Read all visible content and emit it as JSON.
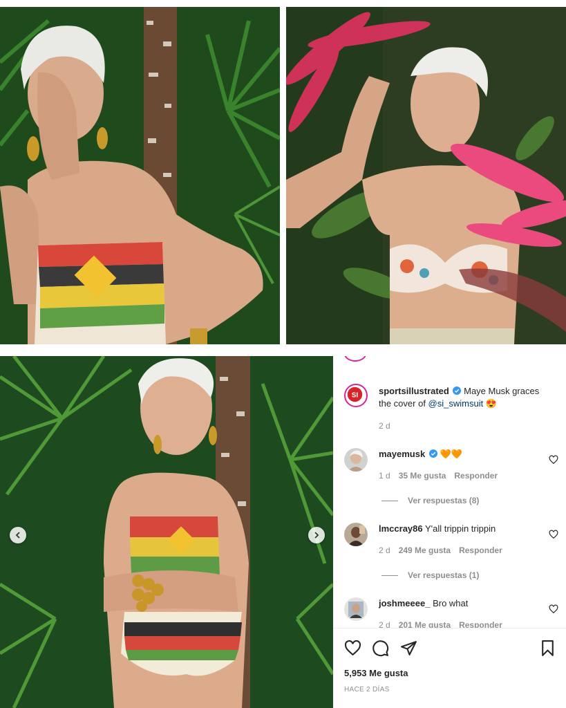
{
  "images": {
    "top_left": "maye-musk-one-piece-hand-on-face",
    "top_right": "maye-musk-floral-bikini-red-leaves",
    "bottom": "maye-musk-one-piece-arms-crossed"
  },
  "carousel": {
    "prev_icon": "chevron-left-icon",
    "next_icon": "chevron-right-icon"
  },
  "post": {
    "author": "sportsillustrated",
    "caption_text": "Maye Musk graces the cover of ",
    "mention": "@si_swimsuit",
    "emoji": "😍",
    "time": "2 d",
    "likes": "5,953 Me gusta",
    "posted": "HACE 2 DÍAS"
  },
  "comments": [
    {
      "user": "mayemusk",
      "verified": true,
      "text": "🧡🧡",
      "time": "1 d",
      "likes": "35 Me gusta",
      "reply": "Responder",
      "view_replies": "Ver respuestas (8)"
    },
    {
      "user": "lmccray86",
      "verified": false,
      "text": "Y'all trippin trippin",
      "time": "2 d",
      "likes": "249 Me gusta",
      "reply": "Responder",
      "view_replies": "Ver respuestas (1)"
    },
    {
      "user": "joshmeeee_",
      "verified": false,
      "text": "Bro what",
      "time": "2 d",
      "likes": "201 Me gusta",
      "reply": "Responder"
    }
  ],
  "actions": [
    "heart-icon",
    "comment-icon",
    "share-icon",
    "bookmark-icon"
  ],
  "colors": {
    "verified": "#3897f0",
    "si_red": "#d5252b",
    "text": "#262626",
    "muted": "#8e8e8e",
    "link": "#00376b"
  }
}
